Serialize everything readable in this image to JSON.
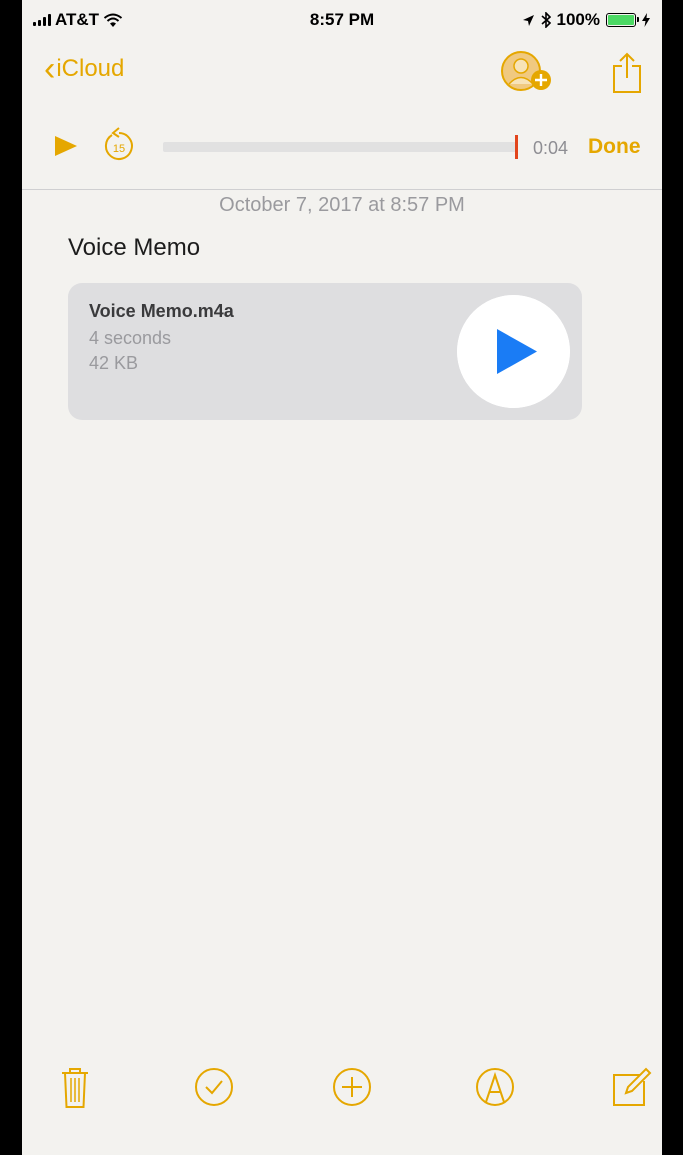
{
  "status_bar": {
    "carrier": "AT&T",
    "time": "8:57 PM",
    "battery": "100%"
  },
  "nav": {
    "back_label": "iCloud"
  },
  "player": {
    "elapsed": "0:04",
    "done_label": "Done",
    "skip_seconds": "15",
    "progress": 1.0
  },
  "note": {
    "date": "October 7, 2017 at 8:57 PM",
    "title": "Voice Memo",
    "attachment": {
      "filename": "Voice Memo.m4a",
      "duration": "4 seconds",
      "size": "42 KB"
    }
  },
  "toolbar": {
    "icons": [
      "trash-icon",
      "checklist-icon",
      "add-icon",
      "sketch-icon",
      "compose-icon"
    ]
  },
  "colors": {
    "accent": "#e5a700",
    "play_blue": "#1a7cf5",
    "playhead": "#e2451c"
  }
}
